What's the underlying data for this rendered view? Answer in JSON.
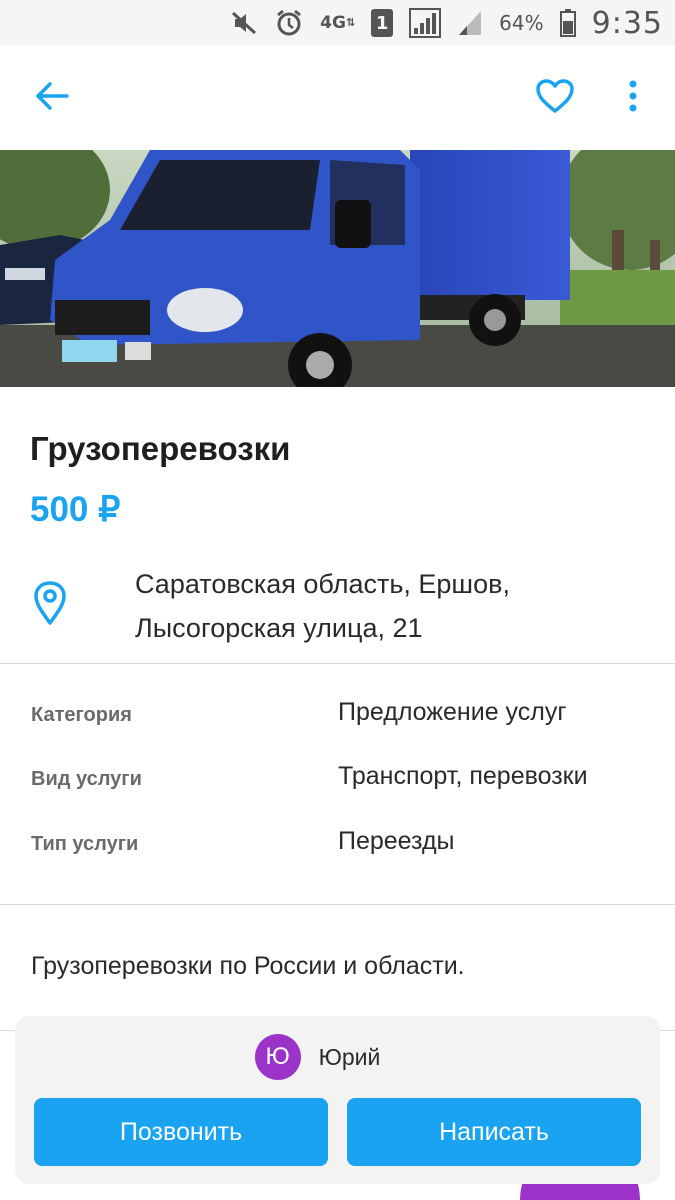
{
  "status_bar": {
    "network": "4G",
    "sim_slot": "1",
    "battery": "64%",
    "time": "9:35",
    "icons": [
      "mute-icon",
      "alarm-icon",
      "network-4g-icon",
      "sim-icon",
      "signal-icon",
      "signal-weak-icon",
      "battery-icon"
    ]
  },
  "toolbar": {
    "back_icon": "arrow-left-icon",
    "favorite_icon": "heart-outline-icon",
    "more_icon": "more-vertical-icon"
  },
  "listing": {
    "title": "Грузоперевозки",
    "price": "500 ₽",
    "address_line1": "Саратовская область, Ершов,",
    "address_line2": "Лысогорская улица, 21",
    "params": [
      {
        "label": "Категория",
        "value": "Предложение услуг"
      },
      {
        "label": "Вид услуги",
        "value": "Транспорт, перевозки"
      },
      {
        "label": "Тип услуги",
        "value": "Переезды"
      }
    ],
    "description": "Грузоперевозки по России и области."
  },
  "contact": {
    "avatar_letter": "Ю",
    "seller_name": "Юрий",
    "call_label": "Позвонить",
    "message_label": "Написать"
  },
  "colors": {
    "accent": "#1aa3f0",
    "avatar": "#9b33c9",
    "panel": "#f3f3f3"
  }
}
